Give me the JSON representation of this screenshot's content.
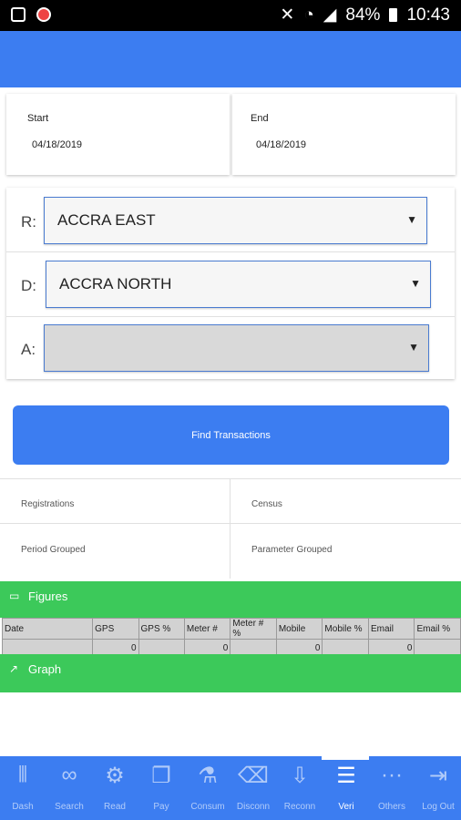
{
  "status_bar": {
    "battery": "84%",
    "time": "10:43"
  },
  "date_range": {
    "start_label": "Start",
    "start_value": "04/18/2019",
    "end_label": "End",
    "end_value": "04/18/2019"
  },
  "filters": [
    {
      "label": "R:",
      "value": "ACCRA EAST"
    },
    {
      "label": "D:",
      "value": "ACCRA NORTH"
    },
    {
      "label": "A:",
      "value": ""
    }
  ],
  "find_button": "Find Transactions",
  "report_options": [
    "Registrations",
    "Census",
    "Period Grouped",
    "Parameter Grouped"
  ],
  "figures": {
    "title": "Figures",
    "columns": [
      "Date",
      "GPS",
      "GPS %",
      "Meter #",
      "Meter # %",
      "Mobile",
      "Mobile %",
      "Email",
      "Email %"
    ],
    "row": [
      "",
      "0",
      "",
      "0",
      "",
      "0",
      "",
      "0",
      ""
    ]
  },
  "graph": {
    "title": "Graph"
  },
  "bottom_nav": [
    {
      "label": "Dash",
      "icon": "barcode-icon"
    },
    {
      "label": "Search",
      "icon": "glasses-icon"
    },
    {
      "label": "Read",
      "icon": "gear-icon"
    },
    {
      "label": "Pay",
      "icon": "document-icon"
    },
    {
      "label": "Consum",
      "icon": "flask-icon"
    },
    {
      "label": "Disconn",
      "icon": "backspace-icon"
    },
    {
      "label": "Reconn",
      "icon": "download-icon"
    },
    {
      "label": "Veri",
      "icon": "list-icon"
    },
    {
      "label": "Others",
      "icon": "dots-icon"
    },
    {
      "label": "Log Out",
      "icon": "logout-icon"
    }
  ],
  "active_nav": "Veri",
  "colors": {
    "primary": "#3c7df1",
    "section": "#3cc95a"
  }
}
